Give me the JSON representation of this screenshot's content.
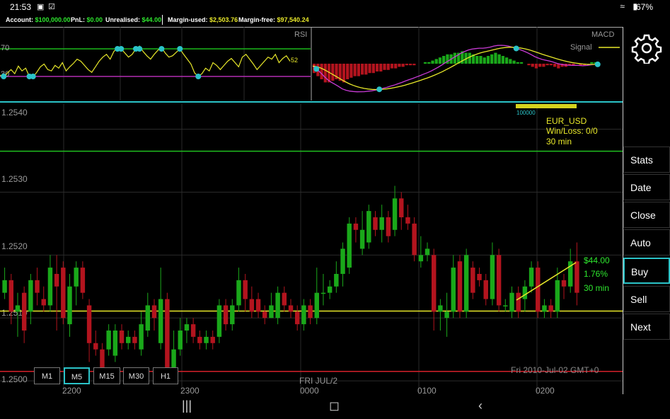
{
  "status": {
    "time": "21:53",
    "battery": "67%"
  },
  "account": {
    "account_label": "Account:",
    "account_value": "$100,000.00",
    "pnl_label": "PnL:",
    "pnl_value": "$0.00",
    "unrealised_label": "Unrealised:",
    "unrealised_value": "$44.00",
    "margin_used_label": "Margin-used:",
    "margin_used_value": "$2,503.76",
    "margin_free_label": "Margin-free:",
    "margin_free_value": "$97,540.24"
  },
  "rsi": {
    "title": "RSI",
    "level_high": "70",
    "level_low": "30",
    "current": "52"
  },
  "macd": {
    "title": "MACD",
    "signal_label": "Signal"
  },
  "info": {
    "instrument": "EUR_USD",
    "winloss": "Win/Loss: 0/0",
    "timeframe": "30 min",
    "volume": "100000"
  },
  "position": {
    "profit": "$44.00",
    "percent": "1.76%",
    "duration": "30 min"
  },
  "date_label": "FRI JUL/2",
  "timestamp": "Fri 2010-Jul-02 GMT+0",
  "sidebar": [
    "Stats",
    "Date",
    "Close",
    "Auto",
    "Buy",
    "Sell",
    "Next"
  ],
  "sidebar_active": "Buy",
  "timeframes": [
    "M1",
    "M5",
    "M15",
    "M30",
    "H1"
  ],
  "timeframe_active": "M5",
  "colors": {
    "up": "#1aa81a",
    "down": "#b3141e",
    "line": "#e8e82a",
    "accent": "#2bc3c8"
  },
  "chart_data": {
    "type": "candlestick",
    "y_ticks": [
      "1.2540",
      "1.2530",
      "1.2520",
      "1.2510",
      "1.2500"
    ],
    "x_ticks": [
      "2200",
      "2300",
      "0000",
      "0100",
      "0200"
    ],
    "ylim": [
      1.2499,
      1.2544
    ],
    "resistance": 1.25365,
    "support": 1.25015,
    "entry": 1.25111,
    "candles": [
      [
        1.2514,
        1.2516,
        1.2518,
        1.2513
      ],
      [
        1.2516,
        1.2511,
        1.2517,
        1.2509
      ],
      [
        1.2511,
        1.2512,
        1.2514,
        1.2507
      ],
      [
        1.2514,
        1.2508,
        1.2515,
        1.2506
      ],
      [
        1.2511,
        1.2516,
        1.2517,
        1.2509
      ],
      [
        1.2516,
        1.2514,
        1.2518,
        1.2512
      ],
      [
        1.2513,
        1.2512,
        1.2515,
        1.2511
      ],
      [
        1.2512,
        1.2518,
        1.252,
        1.2511
      ],
      [
        1.2517,
        1.2515,
        1.252,
        1.2508
      ],
      [
        1.2518,
        1.251,
        1.2519,
        1.2509
      ],
      [
        1.2509,
        1.2515,
        1.2517,
        1.2507
      ],
      [
        1.2515,
        1.2518,
        1.2519,
        1.2512
      ],
      [
        1.2518,
        1.2514,
        1.2519,
        1.2513
      ],
      [
        1.2512,
        1.2506,
        1.2513,
        1.2503
      ],
      [
        1.2506,
        1.2505,
        1.2508,
        1.2504
      ],
      [
        1.2505,
        1.2502,
        1.2506,
        1.2502
      ],
      [
        1.2505,
        1.2508,
        1.2509,
        1.2504
      ],
      [
        1.2504,
        1.2508,
        1.2509,
        1.2503
      ],
      [
        1.2508,
        1.2506,
        1.2509,
        1.2505
      ],
      [
        1.2506,
        1.2507,
        1.2508,
        1.2505
      ],
      [
        1.2507,
        1.2506,
        1.2508,
        1.2505
      ],
      [
        1.2505,
        1.2509,
        1.2511,
        1.2504
      ],
      [
        1.2508,
        1.2512,
        1.2514,
        1.2507
      ],
      [
        1.2512,
        1.251,
        1.2513,
        1.2508
      ],
      [
        1.2506,
        1.2513,
        1.2518,
        1.2505
      ],
      [
        1.2513,
        1.2502,
        1.2514,
        1.2501
      ],
      [
        1.2502,
        1.2505,
        1.2508,
        1.2501
      ],
      [
        1.2505,
        1.2508,
        1.251,
        1.2504
      ],
      [
        1.2508,
        1.2509,
        1.251,
        1.2506
      ],
      [
        1.2509,
        1.2507,
        1.251,
        1.2506
      ],
      [
        1.2507,
        1.2506,
        1.2508,
        1.2505
      ],
      [
        1.2506,
        1.2507,
        1.2508,
        1.2505
      ],
      [
        1.2507,
        1.2506,
        1.2508,
        1.2505
      ],
      [
        1.2507,
        1.2512,
        1.2513,
        1.2506
      ],
      [
        1.2512,
        1.2509,
        1.2513,
        1.2508
      ],
      [
        1.2509,
        1.2512,
        1.2513,
        1.2508
      ],
      [
        1.2512,
        1.2516,
        1.2518,
        1.2511
      ],
      [
        1.2516,
        1.2513,
        1.2517,
        1.2511
      ],
      [
        1.2513,
        1.2511,
        1.2515,
        1.251
      ],
      [
        1.2513,
        1.2511,
        1.2514,
        1.251
      ],
      [
        1.2511,
        1.251,
        1.2512,
        1.2509
      ],
      [
        1.251,
        1.2512,
        1.2514,
        1.251
      ],
      [
        1.251,
        1.2514,
        1.2515,
        1.2509
      ],
      [
        1.2514,
        1.2512,
        1.2515,
        1.2511
      ],
      [
        1.2512,
        1.2511,
        1.2513,
        1.251
      ],
      [
        1.2511,
        1.2509,
        1.2512,
        1.2508
      ],
      [
        1.2509,
        1.2512,
        1.2513,
        1.2508
      ],
      [
        1.2512,
        1.251,
        1.2513,
        1.2509
      ],
      [
        1.251,
        1.2514,
        1.2518,
        1.2509
      ],
      [
        1.2514,
        1.2514,
        1.2517,
        1.2512
      ],
      [
        1.2514,
        1.2515,
        1.2516,
        1.2513
      ],
      [
        1.2515,
        1.2517,
        1.2519,
        1.2514
      ],
      [
        1.2517,
        1.2521,
        1.2522,
        1.2515
      ],
      [
        1.2518,
        1.2525,
        1.2526,
        1.2517
      ],
      [
        1.2525,
        1.2524,
        1.2526,
        1.2522
      ],
      [
        1.2521,
        1.2524,
        1.2527,
        1.252
      ],
      [
        1.2522,
        1.2527,
        1.2528,
        1.2521
      ],
      [
        1.2526,
        1.2524,
        1.2527,
        1.2523
      ],
      [
        1.2524,
        1.2526,
        1.2528,
        1.2522
      ],
      [
        1.2526,
        1.2523,
        1.2527,
        1.2522
      ],
      [
        1.2524,
        1.2529,
        1.2531,
        1.2523
      ],
      [
        1.2529,
        1.2526,
        1.253,
        1.2524
      ],
      [
        1.2526,
        1.2525,
        1.2528,
        1.2524
      ],
      [
        1.2525,
        1.252,
        1.2526,
        1.2519
      ],
      [
        1.2519,
        1.252,
        1.2523,
        1.2518
      ],
      [
        1.252,
        1.2521,
        1.2522,
        1.2519
      ],
      [
        1.252,
        1.2511,
        1.2521,
        1.2508
      ],
      [
        1.2511,
        1.2512,
        1.2513,
        1.2508
      ],
      [
        1.251,
        1.2511,
        1.2514,
        1.2507
      ],
      [
        1.2511,
        1.2518,
        1.252,
        1.251
      ],
      [
        1.2519,
        1.2511,
        1.252,
        1.251
      ],
      [
        1.2511,
        1.252,
        1.2521,
        1.251
      ],
      [
        1.2518,
        1.2514,
        1.2519,
        1.2513
      ],
      [
        1.2517,
        1.2516,
        1.2518,
        1.2515
      ],
      [
        1.2516,
        1.2513,
        1.2517,
        1.2512
      ],
      [
        1.2513,
        1.252,
        1.2522,
        1.2512
      ],
      [
        1.252,
        1.2512,
        1.2521,
        1.2511
      ],
      [
        1.2512,
        1.2512,
        1.2513,
        1.2511
      ],
      [
        1.2511,
        1.2514,
        1.2515,
        1.251
      ],
      [
        1.2514,
        1.2511,
        1.2515,
        1.251
      ],
      [
        1.2513,
        1.2515,
        1.2516,
        1.2511
      ],
      [
        1.2515,
        1.2518,
        1.2519,
        1.2514
      ],
      [
        1.2518,
        1.2511,
        1.2519,
        1.251
      ],
      [
        1.2511,
        1.2512,
        1.2513,
        1.251
      ],
      [
        1.2512,
        1.2511,
        1.2513,
        1.251
      ],
      [
        1.2511,
        1.2516,
        1.2518,
        1.251
      ],
      [
        1.2516,
        1.2515,
        1.2517,
        1.2513
      ],
      [
        1.2515,
        1.2519,
        1.2521,
        1.2514
      ],
      [
        1.2519,
        1.2514,
        1.2522,
        1.2512
      ]
    ],
    "rsi_values": [
      32,
      28,
      35,
      40,
      34,
      45,
      38,
      42,
      30,
      29,
      36,
      44,
      48,
      40,
      38,
      46,
      42,
      50,
      38,
      44,
      49,
      55,
      52,
      46,
      40,
      36,
      44,
      52,
      58,
      62,
      55,
      66,
      72,
      70,
      64,
      58,
      62,
      70,
      74,
      66,
      60,
      55,
      62,
      68,
      72,
      64,
      58,
      60,
      65,
      70,
      62,
      55,
      48,
      35,
      30,
      34,
      42,
      38,
      50,
      46,
      40,
      46,
      52,
      56,
      50,
      44,
      58,
      62,
      55,
      48,
      40,
      46,
      52,
      58,
      55,
      62,
      50,
      56,
      60,
      52
    ],
    "macd_hist": [
      -6,
      -8,
      -10,
      -12,
      -12,
      -11,
      -10,
      -11,
      -12,
      -10,
      -9,
      -8,
      -8,
      -7,
      -7,
      -6,
      -6,
      -5,
      -5,
      -4,
      -4,
      -3,
      -3,
      -2,
      -2,
      -1,
      -1,
      -1,
      0,
      0,
      1,
      1,
      2,
      3,
      4,
      5,
      6,
      6,
      7,
      7,
      8,
      7,
      7,
      6,
      5,
      5,
      4,
      5,
      6,
      7,
      6,
      5,
      4,
      3,
      2,
      1,
      1,
      0,
      -1,
      -2,
      -3,
      -2,
      -2,
      -1,
      -1,
      -2,
      -3,
      -2,
      -2,
      -1,
      -1,
      0,
      -1,
      -1,
      0,
      1,
      1,
      0
    ]
  }
}
